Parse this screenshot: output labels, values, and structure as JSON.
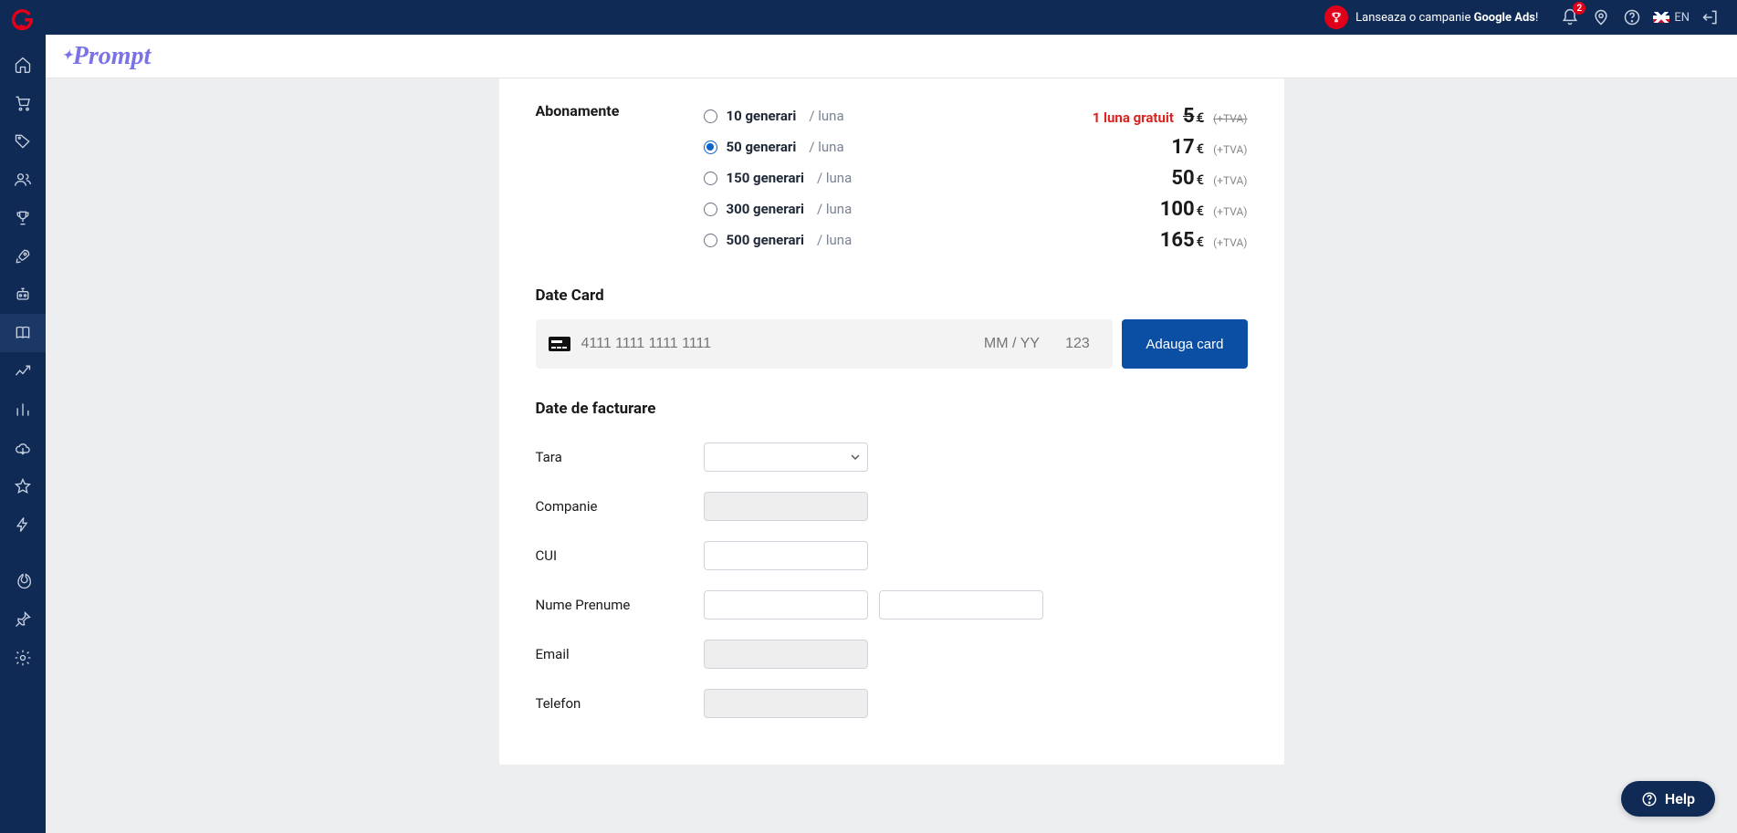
{
  "topbar": {
    "campaign_prefix": "Lanseaza o campanie ",
    "campaign_bold": "Google Ads",
    "campaign_suffix": "!",
    "notif_count": "2",
    "lang": "EN"
  },
  "subheader": {
    "brand": "Prompt"
  },
  "subscriptions": {
    "label": "Abonamente",
    "per_unit": "/ luna",
    "tva": "(+TVA)",
    "currency": "€",
    "promo": "1 luna gratuit",
    "plans": [
      {
        "name": "10 generari",
        "price": "5",
        "promo": true,
        "selected": false
      },
      {
        "name": "50 generari",
        "price": "17",
        "promo": false,
        "selected": true
      },
      {
        "name": "150 generari",
        "price": "50",
        "promo": false,
        "selected": false
      },
      {
        "name": "300 generari",
        "price": "100",
        "promo": false,
        "selected": false
      },
      {
        "name": "500 generari",
        "price": "165",
        "promo": false,
        "selected": false
      }
    ]
  },
  "card_section": {
    "title": "Date Card",
    "num_placeholder": "4111 1111 1111 1111",
    "exp_placeholder": "MM / YY",
    "cvv_placeholder": "123",
    "add_button": "Adauga card"
  },
  "billing": {
    "title": "Date de facturare",
    "fields": {
      "country": "Tara",
      "company": "Companie",
      "cui": "CUI",
      "name": "Nume Prenume",
      "email": "Email",
      "phone": "Telefon"
    }
  },
  "help": {
    "label": "Help"
  }
}
